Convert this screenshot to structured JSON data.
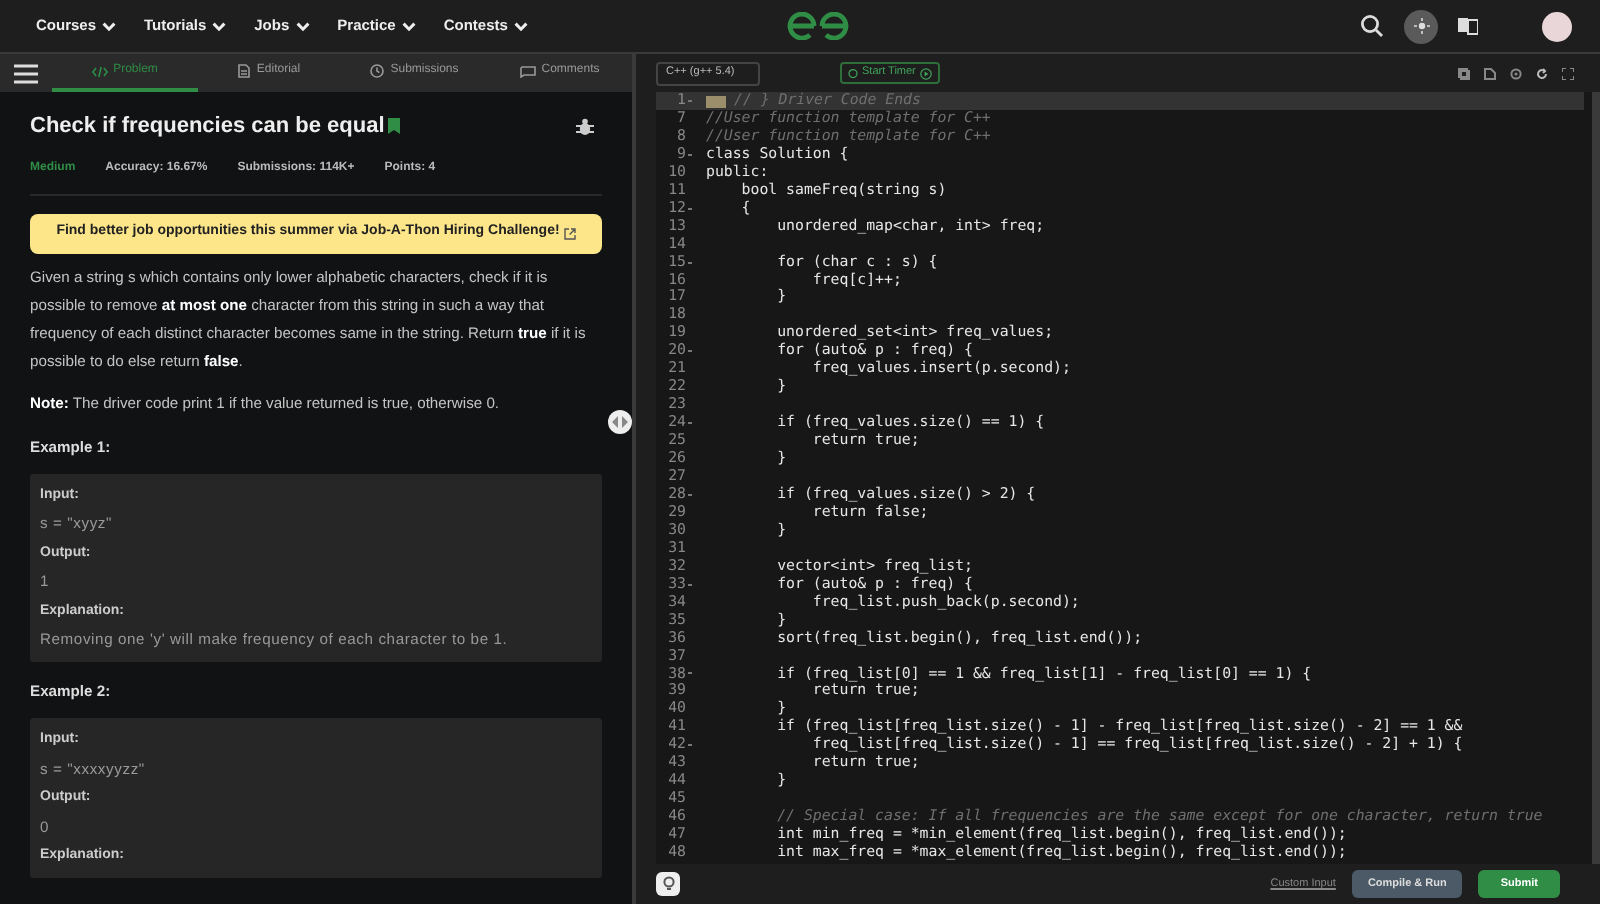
{
  "nav": {
    "menus": [
      {
        "label": "Courses"
      },
      {
        "label": "Tutorials"
      },
      {
        "label": "Jobs"
      },
      {
        "label": "Practice"
      },
      {
        "label": "Contests"
      }
    ]
  },
  "tabs": [
    {
      "label": "Problem",
      "selected": true
    },
    {
      "label": "Editorial",
      "selected": false
    },
    {
      "label": "Submissions",
      "selected": false
    },
    {
      "label": "Comments",
      "selected": false
    }
  ],
  "problem": {
    "title": "Check if frequencies can be equal",
    "difficulty": "Medium",
    "stats": [
      "Accuracy: 16.67%",
      "Submissions: 114K+",
      "Points: 4"
    ],
    "banner": "Find better job opportunities this summer via Job-A-Thon Hiring Challenge!",
    "paragraphs": [
      "Given a string s which contains only lower alphabetic characters, check if it is possible to remove **at most one** character from this string in such a way that frequency of each distinct character becomes same in the string. Return **true** if it is possible to do else return **false**.",
      "**Note:** The driver code print 1 if the value returned is true, otherwise 0."
    ],
    "examples": [
      {
        "heading": "Example 1:",
        "lines": [
          {
            "kind": "label",
            "text": "Input:"
          },
          {
            "kind": "value",
            "text": "s = \"xyyz\""
          },
          {
            "kind": "label",
            "text": "Output:"
          },
          {
            "kind": "value",
            "text": "1"
          },
          {
            "kind": "label",
            "text": "Explanation:"
          },
          {
            "kind": "value",
            "text": "Removing one 'y' will make frequency of each character to be 1."
          }
        ]
      },
      {
        "heading": "Example 2:",
        "lines": [
          {
            "kind": "label",
            "text": "Input:"
          },
          {
            "kind": "value",
            "text": "s = \"xxxxyyzz\""
          },
          {
            "kind": "label",
            "text": "Output:"
          },
          {
            "kind": "value",
            "text": "0"
          },
          {
            "kind": "label",
            "text": "Explanation:"
          }
        ]
      }
    ]
  },
  "editor": {
    "language": "C++ (g++ 5.4)",
    "timer": "Start Timer",
    "lines": [
      {
        "number": "1",
        "kind": "folded",
        "fold": true,
        "code": "// } Driver Code Ends"
      },
      {
        "number": "7",
        "kind": "comment",
        "fold": false,
        "code": "//User function template for C++"
      },
      {
        "number": "8",
        "kind": "comment",
        "fold": false,
        "code": "//User function template for C++"
      },
      {
        "number": "9",
        "kind": "code",
        "fold": true,
        "code": "class Solution {"
      },
      {
        "number": "10",
        "kind": "code",
        "fold": false,
        "code": "public:"
      },
      {
        "number": "11",
        "kind": "code",
        "fold": false,
        "code": "    bool sameFreq(string s)"
      },
      {
        "number": "12",
        "kind": "code",
        "fold": true,
        "code": "    {"
      },
      {
        "number": "13",
        "kind": "code",
        "fold": false,
        "code": "        unordered_map<char, int> freq;"
      },
      {
        "number": "14",
        "kind": "code",
        "fold": false
      },
      {
        "number": "15",
        "kind": "code",
        "fold": true,
        "code": "        for (char c : s) {"
      },
      {
        "number": "16",
        "kind": "code",
        "fold": false,
        "code": "            freq[c]++;"
      },
      {
        "number": "17",
        "kind": "code",
        "fold": false,
        "code": "        }"
      },
      {
        "number": "18",
        "kind": "code",
        "fold": false
      },
      {
        "number": "19",
        "kind": "code",
        "fold": false,
        "code": "        unordered_set<int> freq_values;"
      },
      {
        "number": "20",
        "kind": "code",
        "fold": true,
        "code": "        for (auto& p : freq) {"
      },
      {
        "number": "21",
        "kind": "code",
        "fold": false,
        "code": "            freq_values.insert(p.second);"
      },
      {
        "number": "22",
        "kind": "code",
        "fold": false,
        "code": "        }"
      },
      {
        "number": "23",
        "kind": "code",
        "fold": false
      },
      {
        "number": "24",
        "kind": "code",
        "fold": true,
        "code": "        if (freq_values.size() == 1) {"
      },
      {
        "number": "25",
        "kind": "code",
        "fold": false,
        "code": "            return true;"
      },
      {
        "number": "26",
        "kind": "code",
        "fold": false,
        "code": "        }"
      },
      {
        "number": "27",
        "kind": "code",
        "fold": false
      },
      {
        "number": "28",
        "kind": "code",
        "fold": true,
        "code": "        if (freq_values.size() > 2) {"
      },
      {
        "number": "29",
        "kind": "code",
        "fold": false,
        "code": "            return false;"
      },
      {
        "number": "30",
        "kind": "code",
        "fold": false,
        "code": "        }"
      },
      {
        "number": "31",
        "kind": "code",
        "fold": false
      },
      {
        "number": "32",
        "kind": "code",
        "fold": false,
        "code": "        vector<int> freq_list;"
      },
      {
        "number": "33",
        "kind": "code",
        "fold": true,
        "code": "        for (auto& p : freq) {"
      },
      {
        "number": "34",
        "kind": "code",
        "fold": false,
        "code": "            freq_list.push_back(p.second);"
      },
      {
        "number": "35",
        "kind": "code",
        "fold": false,
        "code": "        }"
      },
      {
        "number": "36",
        "kind": "code",
        "fold": false,
        "code": "        sort(freq_list.begin(), freq_list.end());"
      },
      {
        "number": "37",
        "kind": "code",
        "fold": false
      },
      {
        "number": "38",
        "kind": "code",
        "fold": true,
        "code": "        if (freq_list[0] == 1 && freq_list[1] - freq_list[0] == 1) {"
      },
      {
        "number": "39",
        "kind": "code",
        "fold": false,
        "code": "            return true;"
      },
      {
        "number": "40",
        "kind": "code",
        "fold": false,
        "code": "        }"
      },
      {
        "number": "41",
        "kind": "code",
        "fold": false,
        "code": "        if (freq_list[freq_list.size() - 1] - freq_list[freq_list.size() - 2] == 1 &&"
      },
      {
        "number": "42",
        "kind": "code",
        "fold": true,
        "code": "            freq_list[freq_list.size() - 1] == freq_list[freq_list.size() - 2] + 1) {"
      },
      {
        "number": "43",
        "kind": "code",
        "fold": false,
        "code": "            return true;"
      },
      {
        "number": "44",
        "kind": "code",
        "fold": false,
        "code": "        }"
      },
      {
        "number": "45",
        "kind": "code",
        "fold": false
      },
      {
        "number": "46",
        "kind": "comment",
        "fold": false,
        "code": "        // Special case: If all frequencies are the same except for one character, return true"
      },
      {
        "number": "47",
        "kind": "code",
        "fold": false,
        "code": "        int min_freq = *min_element(freq_list.begin(), freq_list.end());"
      },
      {
        "number": "48",
        "kind": "code",
        "fold": false,
        "code": "        int max_freq = *max_element(freq_list.begin(), freq_list.end());"
      }
    ]
  },
  "footer": {
    "custom_input": "Custom Input",
    "run": "Compile & Run",
    "submit": "Submit"
  }
}
